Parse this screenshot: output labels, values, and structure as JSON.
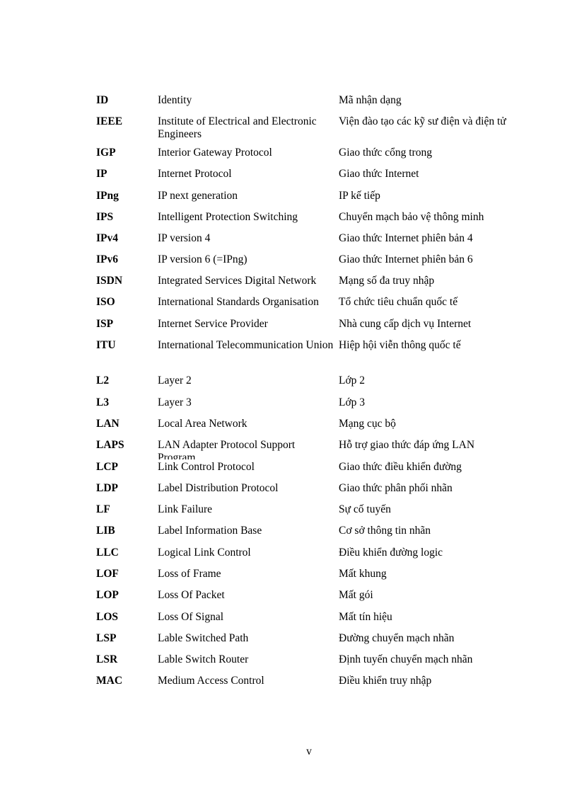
{
  "abbreviations": [
    {
      "abbr": "ID",
      "english": "Identity",
      "vietnamese": "Mã nhận dạng"
    },
    {
      "abbr": "IEEE",
      "english": "Institute of Electrical and Electronic Engineers",
      "vietnamese": "Viện đào tạo các kỹ sư điện và điện tử"
    },
    {
      "abbr": "IGP",
      "english": "Interior Gateway Protocol",
      "vietnamese": "Giao thức cổng trong"
    },
    {
      "abbr": "IP",
      "english": "Internet Protocol",
      "vietnamese": "Giao thức Internet"
    },
    {
      "abbr": "IPng",
      "english": "IP next generation",
      "vietnamese": "IP kế tiếp"
    },
    {
      "abbr": "IPS",
      "english": "Intelligent Protection Switching",
      "vietnamese": "Chuyển mạch bảo vệ thông minh"
    },
    {
      "abbr": "IPv4",
      "english": "IP version 4",
      "vietnamese": "Giao thức Internet phiên bản 4"
    },
    {
      "abbr": "IPv6",
      "english": "IP version 6 (=IPng)",
      "vietnamese": "Giao thức Internet phiên bản 6"
    },
    {
      "abbr": "ISDN",
      "english": "Integrated Services Digital Network",
      "vietnamese": "Mạng số đa truy nhập"
    },
    {
      "abbr": "ISO",
      "english": "International Standards Organisation",
      "vietnamese": "Tổ chức tiêu chuẩn quốc tế"
    },
    {
      "abbr": "ISP",
      "english": "Internet Service Provider",
      "vietnamese": "Nhà cung cấp dịch vụ Internet"
    },
    {
      "abbr": "ITU",
      "english": "International Telecommunication Union",
      "vietnamese": "Hiệp hội viễn thông quốc tế"
    },
    {
      "abbr": "L2",
      "english": "Layer 2",
      "vietnamese": "Lớp 2"
    },
    {
      "abbr": "L3",
      "english": "Layer 3",
      "vietnamese": "Lớp 3"
    },
    {
      "abbr": "LAN",
      "english": "Local Area Network",
      "vietnamese": "Mạng cục bộ"
    },
    {
      "abbr": "LAPS",
      "english": "LAN Adapter Protocol Support Program",
      "vietnamese": "Hỗ trợ giao thức đáp ứng LAN"
    },
    {
      "abbr": "LCP",
      "english": "Link Control Protocol",
      "vietnamese": "Giao thức điều khiển đường"
    },
    {
      "abbr": "LDP",
      "english": "Label Distribution Protocol",
      "vietnamese": "Giao thức phân phối nhãn"
    },
    {
      "abbr": "LF",
      "english": "Link Failure",
      "vietnamese": "Sự cố tuyến"
    },
    {
      "abbr": "LIB",
      "english": "Label Information Base",
      "vietnamese": "Cơ sở thông tin nhãn"
    },
    {
      "abbr": "LLC",
      "english": "Logical Link Control",
      "vietnamese": "Điều khiển đường logic"
    },
    {
      "abbr": "LOF",
      "english": "Loss of Frame",
      "vietnamese": "Mất khung"
    },
    {
      "abbr": "LOP",
      "english": "Loss Of Packet",
      "vietnamese": "Mất gói"
    },
    {
      "abbr": "LOS",
      "english": "Loss Of Signal",
      "vietnamese": "Mất tín hiệu"
    },
    {
      "abbr": "LSP",
      "english": "Lable Switched Path",
      "vietnamese": "Đường chuyển mạch nhãn"
    },
    {
      "abbr": "LSR",
      "english": "Lable Switch Router",
      "vietnamese": "Định tuyến chuyển mạch nhãn"
    },
    {
      "abbr": "MAC",
      "english": "Medium Access Control",
      "vietnamese": "Điều khiển truy nhập"
    }
  ],
  "page_number": "v"
}
